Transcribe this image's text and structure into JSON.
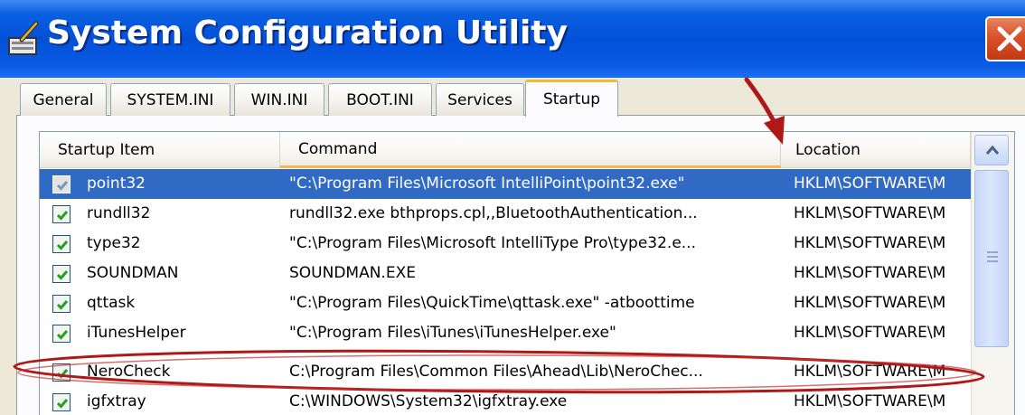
{
  "window": {
    "title": "System Configuration Utility",
    "close_icon": "close-icon",
    "app_icon": "msconfig-icon"
  },
  "tabs": [
    {
      "label": "General"
    },
    {
      "label": "SYSTEM.INI"
    },
    {
      "label": "WIN.INI"
    },
    {
      "label": "BOOT.INI"
    },
    {
      "label": "Services"
    },
    {
      "label": "Startup",
      "active": true
    }
  ],
  "list": {
    "columns": [
      {
        "label": "Startup Item"
      },
      {
        "label": "Command",
        "sorted": true
      },
      {
        "label": "Location"
      }
    ],
    "rows": [
      {
        "item": "point32",
        "command": "\"C:\\Program Files\\Microsoft IntelliPoint\\point32.exe\"",
        "location": "HKLM\\SOFTWARE\\M",
        "checked": true,
        "selected": true
      },
      {
        "item": "rundll32",
        "command": "rundll32.exe bthprops.cpl,,BluetoothAuthentication...",
        "location": "HKLM\\SOFTWARE\\M",
        "checked": true
      },
      {
        "item": "type32",
        "command": "\"C:\\Program Files\\Microsoft IntelliType Pro\\type32.e...",
        "location": "HKLM\\SOFTWARE\\M",
        "checked": true
      },
      {
        "item": "SOUNDMAN",
        "command": "SOUNDMAN.EXE",
        "location": "HKLM\\SOFTWARE\\M",
        "checked": true
      },
      {
        "item": "qttask",
        "command": "\"C:\\Program Files\\QuickTime\\qttask.exe\" -atboottime",
        "location": "HKLM\\SOFTWARE\\M",
        "checked": true
      },
      {
        "item": "iTunesHelper",
        "command": "\"C:\\Program Files\\iTunes\\iTunesHelper.exe\"",
        "location": "HKLM\\SOFTWARE\\M",
        "checked": true
      },
      {
        "item": "NeroCheck",
        "command": "C:\\Program Files\\Common Files\\Ahead\\Lib\\NeroChec...",
        "location": "HKLM\\SOFTWARE\\M",
        "checked": true,
        "highlighted": true
      },
      {
        "item": "igfxtray",
        "command": "C:\\WINDOWS\\System32\\igfxtray.exe",
        "location": "HKLM\\SOFTWARE\\M",
        "checked": true
      }
    ]
  },
  "colors": {
    "selection": "#316ac5",
    "annotation_red": "#b01818",
    "titlebar": "#0250d8"
  }
}
